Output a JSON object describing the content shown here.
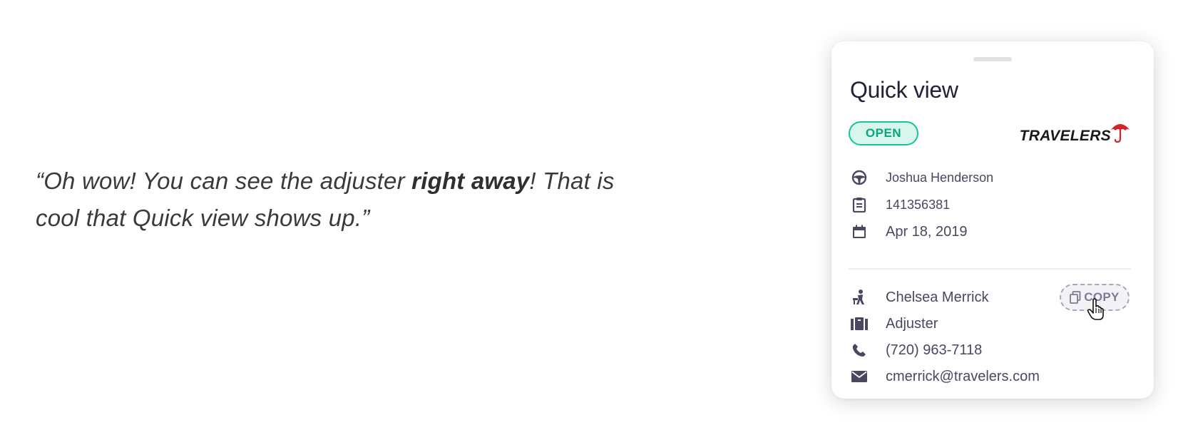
{
  "quote": {
    "before": "“Oh wow! You can see the adjuster ",
    "bold": "right away",
    "after": "! That is cool that Quick view shows up.”"
  },
  "card": {
    "title": "Quick view",
    "status": "OPEN",
    "brand": "TRAVELERS",
    "claim": {
      "driver": "Joshua Henderson",
      "claim_number": "141356381",
      "date": "Apr 18, 2019"
    },
    "adjuster": {
      "name": "Chelsea Merrick",
      "role": "Adjuster",
      "phone": "(720) 963-7118",
      "email": "cmerrick@travelers.com"
    },
    "copy_label": "COPY"
  },
  "colors": {
    "accent_green": "#12c79a",
    "text_dark": "#242038",
    "text_muted": "#4a4761",
    "brand_red": "#d2232a"
  },
  "icons": {
    "driver": "steering-wheel-icon",
    "claim_number": "clipboard-icon",
    "date": "calendar-icon",
    "adjuster": "person-at-desk-icon",
    "role": "badge-icon",
    "phone": "phone-icon",
    "email": "mail-icon",
    "copy": "copy-icon",
    "cursor": "hand-cursor-icon"
  }
}
